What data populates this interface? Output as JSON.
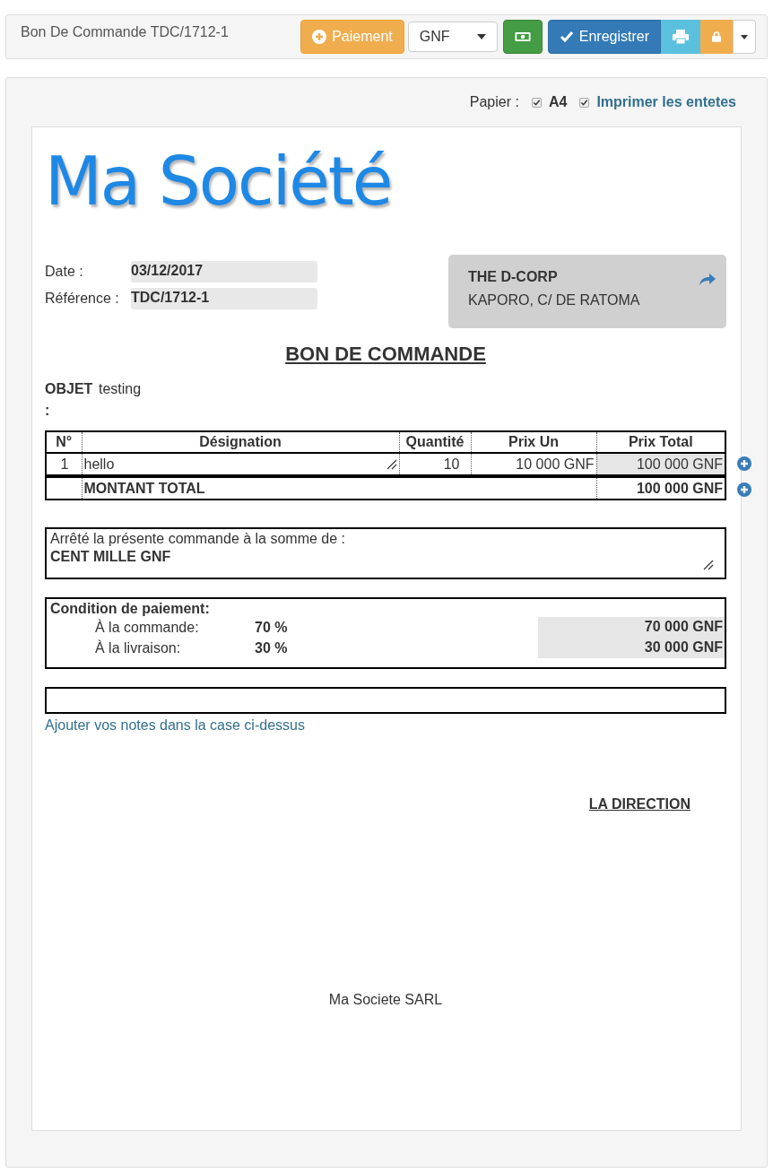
{
  "toolbar": {
    "title": "Bon De Commande TDC/1712-1",
    "payment_button": "Paiement",
    "currency": "GNF",
    "save_button": "Enregistrer"
  },
  "paper_options": {
    "label": "Papier :",
    "options": [
      {
        "label": "A4",
        "checked": true,
        "kind": "plain"
      },
      {
        "label": "Imprimer les entetes",
        "checked": true,
        "kind": "link"
      }
    ]
  },
  "document": {
    "logo": "Ma Société",
    "fields": [
      {
        "label": "Date :",
        "value": "03/12/2017"
      },
      {
        "label": "Référence :",
        "value": "TDC/1712-1"
      }
    ],
    "client": {
      "name": "THE D-CORP",
      "address": "KAPORO, C/ DE RATOMA"
    },
    "heading": "BON DE COMMANDE",
    "object": {
      "label": "OBJET :",
      "value": "testing"
    },
    "table": {
      "columns": [
        "N°",
        "Désignation",
        "Quantité",
        "Prix Un",
        "Prix Total"
      ],
      "rows": [
        {
          "number": "1",
          "designation": "hello",
          "quantity": "10",
          "unit_price": "10 000 GNF",
          "total": "100 000 GNF"
        }
      ],
      "total_label": "MONTANT TOTAL",
      "total_value": "100 000 GNF"
    },
    "amount_in_words": {
      "label": "Arrêté la présente commande à la somme de :",
      "value": "CENT MILLE GNF"
    },
    "payment_terms": {
      "title": "Condition de paiement:",
      "rows": [
        {
          "label": "À la commande:",
          "percent": "70 %",
          "amount": "70 000 GNF"
        },
        {
          "label": "À la livraison:",
          "percent": "30 %",
          "amount": "30 000 GNF"
        }
      ]
    },
    "notes_hint": "Ajouter vos notes dans la case ci-dessus",
    "signature": "LA DIRECTION",
    "footer": "Ma Societe SARL"
  }
}
